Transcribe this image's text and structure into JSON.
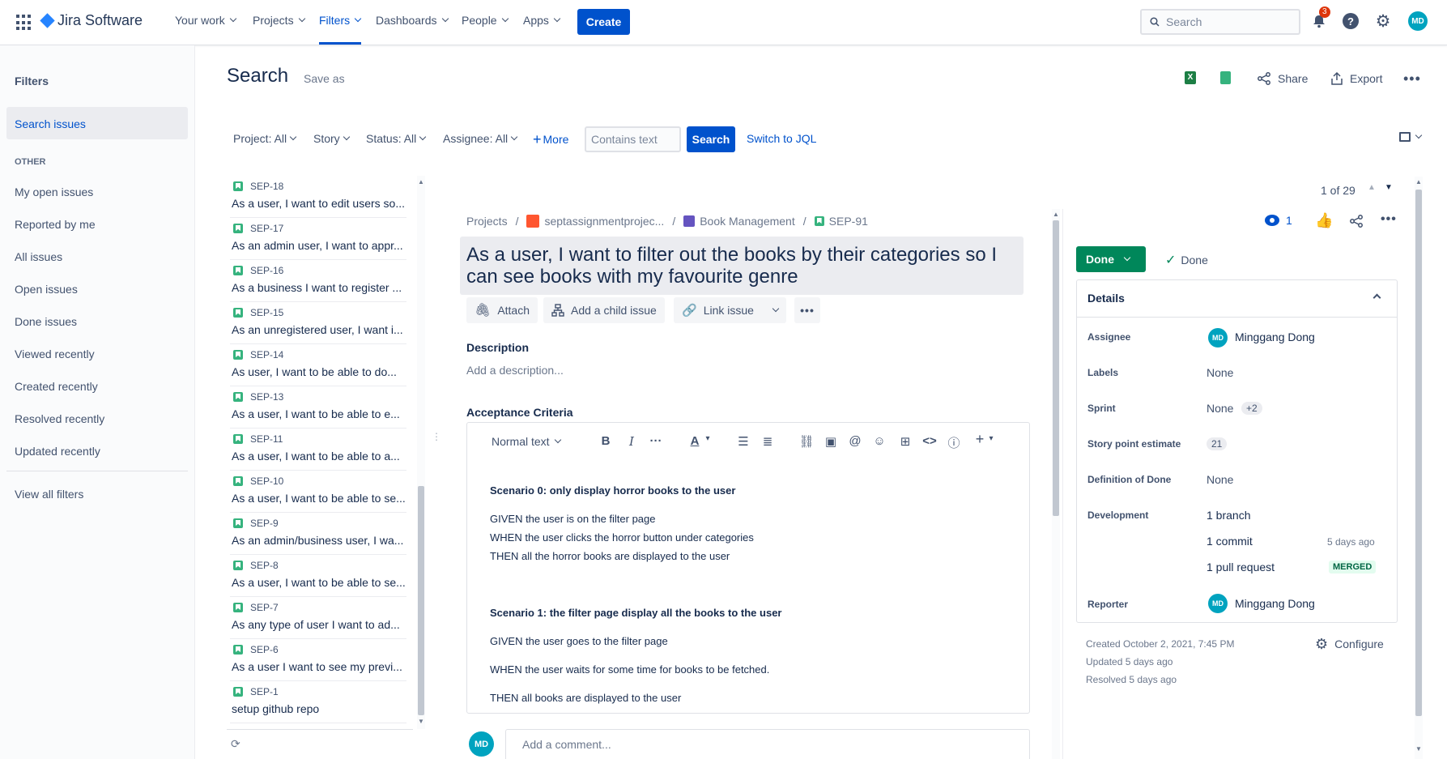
{
  "topnav": {
    "product": "Jira Software",
    "items": [
      {
        "label": "Your work"
      },
      {
        "label": "Projects"
      },
      {
        "label": "Filters"
      },
      {
        "label": "Dashboards"
      },
      {
        "label": "People"
      },
      {
        "label": "Apps"
      }
    ],
    "create_label": "Create",
    "search_placeholder": "Search",
    "notification_count": "3",
    "avatar_initials": "MD"
  },
  "sidebar": {
    "title": "Filters",
    "selected": "Search issues",
    "section_label": "OTHER",
    "items": [
      {
        "label": "My open issues"
      },
      {
        "label": "Reported by me"
      },
      {
        "label": "All issues"
      },
      {
        "label": "Open issues"
      },
      {
        "label": "Done issues"
      },
      {
        "label": "Viewed recently"
      },
      {
        "label": "Created recently"
      },
      {
        "label": "Resolved recently"
      },
      {
        "label": "Updated recently"
      }
    ],
    "view_all": "View all filters"
  },
  "header": {
    "title": "Search",
    "save_as": "Save as",
    "share": "Share",
    "export": "Export"
  },
  "filters": {
    "project": "Project: All",
    "type": "Story",
    "status": "Status: All",
    "assignee": "Assignee: All",
    "more": "More",
    "text_placeholder": "Contains text",
    "search_button": "Search",
    "switch_jql": "Switch to JQL"
  },
  "issue_list": [
    {
      "key": "SEP-18",
      "summary": "As a user, I want to edit users so..."
    },
    {
      "key": "SEP-17",
      "summary": "As an admin user, I want to appr..."
    },
    {
      "key": "SEP-16",
      "summary": "As a business I want to register ..."
    },
    {
      "key": "SEP-15",
      "summary": "As an unregistered user, I want i..."
    },
    {
      "key": "SEP-14",
      "summary": "As user, I want to be able to do..."
    },
    {
      "key": "SEP-13",
      "summary": "As a user, I want to be able to e..."
    },
    {
      "key": "SEP-11",
      "summary": "As a user, I want to be able to a..."
    },
    {
      "key": "SEP-10",
      "summary": "As a user, I want to be able to se..."
    },
    {
      "key": "SEP-9",
      "summary": "As an admin/business user, I wa..."
    },
    {
      "key": "SEP-8",
      "summary": "As a user, I want to be able to se..."
    },
    {
      "key": "SEP-7",
      "summary": "As any type of user I want to ad..."
    },
    {
      "key": "SEP-6",
      "summary": "As a user I want to see my previ..."
    },
    {
      "key": "SEP-1",
      "summary": "setup github repo"
    }
  ],
  "pager": "1 of 29",
  "issue": {
    "breadcrumb": {
      "projects": "Projects",
      "project": "septassignmentprojec...",
      "epic": "Book Management",
      "key": "SEP-91"
    },
    "title": "As a user, I want to filter out the books by their categories so I can see books with my favourite genre",
    "actions": {
      "attach": "Attach",
      "child": "Add a child issue",
      "link": "Link issue"
    },
    "description_label": "Description",
    "description_placeholder": "Add a description...",
    "acceptance_label": "Acceptance Criteria",
    "editor_style": "Normal text",
    "acceptance": {
      "s0_title": "Scenario 0: only display horror books to the user",
      "s0_l1": "GIVEN the user is on the filter page",
      "s0_l2": "WHEN the user clicks the horror button under categories",
      "s0_l3": "THEN all the horror books are displayed to the user",
      "s1_title": "Scenario 1: the filter page display all the books to the user",
      "s1_l1": "GIVEN the user goes to the filter page",
      "s1_l2": "WHEN the user waits for some time for books to be fetched.",
      "s1_l3": "THEN all books are displayed to the user"
    },
    "comment_placeholder": "Add a comment...",
    "watchers": "1",
    "status_button": "Done",
    "resolution": "Done",
    "details": {
      "title": "Details",
      "assignee_label": "Assignee",
      "assignee": "Minggang Dong",
      "labels_label": "Labels",
      "labels": "None",
      "sprint_label": "Sprint",
      "sprint": "None",
      "sprint_more": "+2",
      "points_label": "Story point estimate",
      "points": "21",
      "dod_label": "Definition of Done",
      "dod": "None",
      "dev_label": "Development",
      "branch": "1 branch",
      "commit": "1 commit",
      "commit_time": "5 days ago",
      "pr": "1 pull request",
      "pr_status": "MERGED",
      "reporter_label": "Reporter",
      "reporter": "Minggang Dong"
    },
    "created": "Created October 2, 2021, 7:45 PM",
    "updated": "Updated 5 days ago",
    "resolved": "Resolved 5 days ago",
    "configure": "Configure"
  },
  "colors": {
    "brand": "#0052cc",
    "done_green": "#00875a",
    "story_green": "#36b37e"
  }
}
